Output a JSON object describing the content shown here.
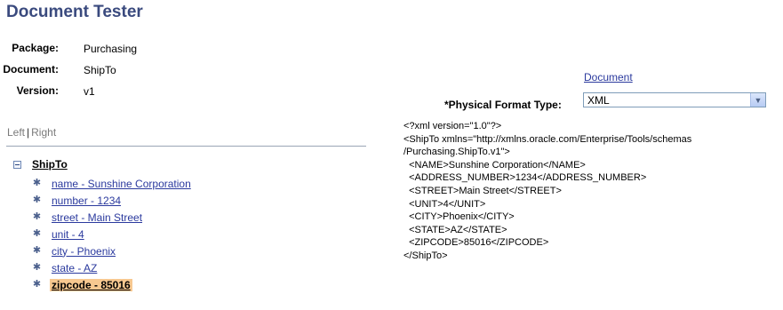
{
  "page": {
    "title": "Document Tester"
  },
  "meta": {
    "package_label": "Package:",
    "package_value": "Purchasing",
    "document_label": "Document:",
    "document_value": "ShipTo",
    "version_label": "Version:",
    "version_value": "v1"
  },
  "document_link": "Document",
  "physical_format": {
    "label": "*Physical Format Type:",
    "value": "XML"
  },
  "tabs": {
    "left": "Left",
    "separator": "|",
    "right": "Right"
  },
  "tree": {
    "root": "ShipTo",
    "items": [
      {
        "label": "name - Sunshine Corporation"
      },
      {
        "label": "number - 1234"
      },
      {
        "label": "street - Main Street"
      },
      {
        "label": "unit - 4"
      },
      {
        "label": "city - Phoenix"
      },
      {
        "label": "state - AZ"
      },
      {
        "label": "zipcode - 85016",
        "selected": true
      }
    ]
  },
  "xml_lines": [
    "<?xml version=\"1.0\"?>",
    "<ShipTo xmlns=\"http://xmlns.oracle.com/Enterprise/Tools/schemas",
    "/Purchasing.ShipTo.v1\">",
    "  <NAME>Sunshine Corporation</NAME>",
    "  <ADDRESS_NUMBER>1234</ADDRESS_NUMBER>",
    "  <STREET>Main Street</STREET>",
    "  <UNIT>4</UNIT>",
    "  <CITY>Phoenix</CITY>",
    "  <STATE>AZ</STATE>",
    "  <ZIPCODE>85016</ZIPCODE>",
    "</ShipTo>"
  ],
  "icons": {
    "minus": "collapse-minus-icon",
    "leaf": "gear-node-icon",
    "dropdown": "chevron-down-icon"
  }
}
